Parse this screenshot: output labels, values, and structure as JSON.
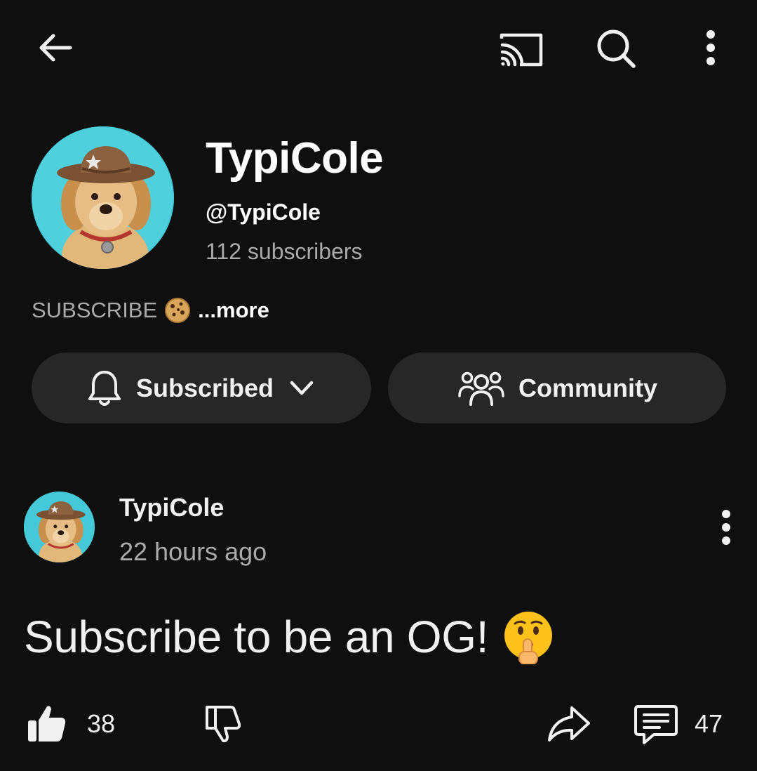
{
  "topbar": {
    "back_icon": "arrow-left-icon",
    "cast_icon": "cast-icon",
    "search_icon": "search-icon",
    "menu_icon": "more-vert-icon"
  },
  "channel": {
    "name": "TypiCole",
    "handle": "@TypiCole",
    "subscribers": "112 subscribers",
    "description": "SUBSCRIBE",
    "more_label": "...more",
    "avatar_bg": "#45c9d8"
  },
  "actions": {
    "subscribed_label": "Subscribed",
    "community_label": "Community"
  },
  "post": {
    "author": "TypiCole",
    "time": "22 hours ago",
    "text": "Subscribe to be an OG!",
    "likes": "38",
    "comments": "47"
  },
  "colors": {
    "background": "#0f0f0f",
    "pill": "#272727",
    "secondary_text": "#aaaaaa",
    "primary_text": "#f1f1f1"
  }
}
